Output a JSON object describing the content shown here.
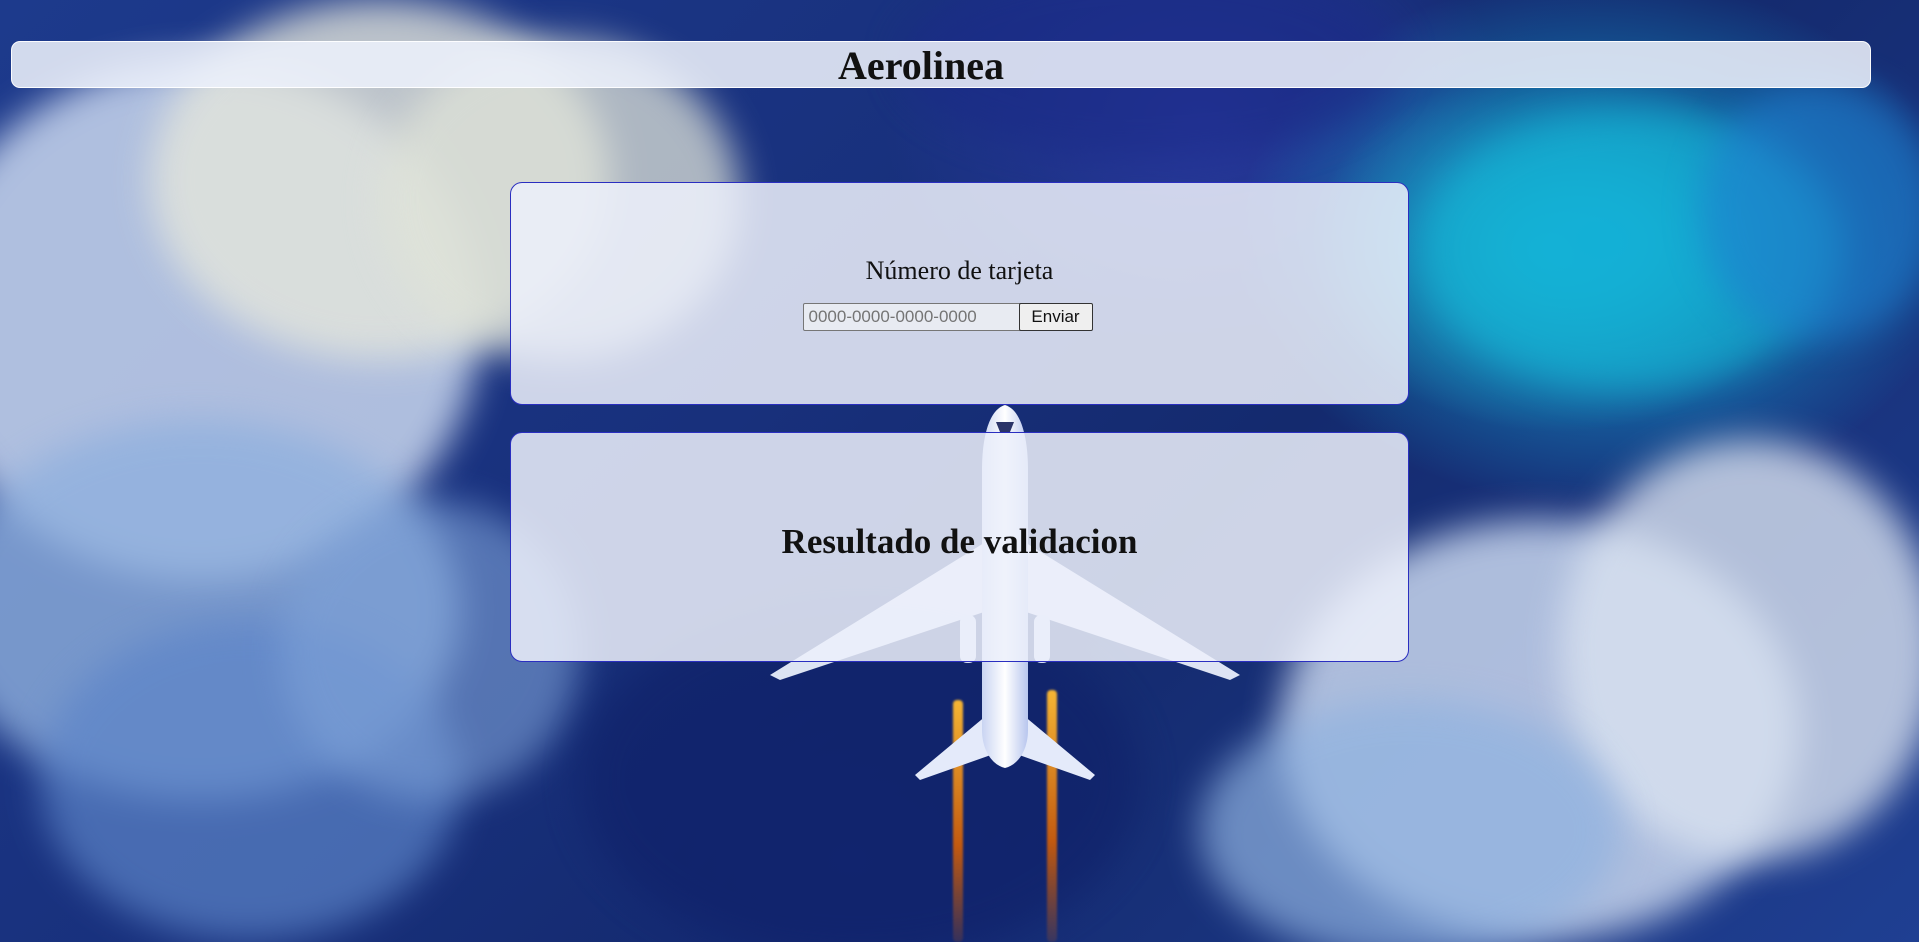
{
  "header": {
    "title": "Aerolinea"
  },
  "form": {
    "label": "Número de tarjeta",
    "card_input_value": "",
    "card_input_placeholder": "0000-0000-0000-0000",
    "submit_label": "Enviar"
  },
  "result": {
    "title": "Resultado de validacion"
  },
  "colors": {
    "panel_background": "#eceffa",
    "panel_border": "#2a2ec0",
    "background_dark": "#18307c",
    "background_accent": "#12a7d8"
  }
}
